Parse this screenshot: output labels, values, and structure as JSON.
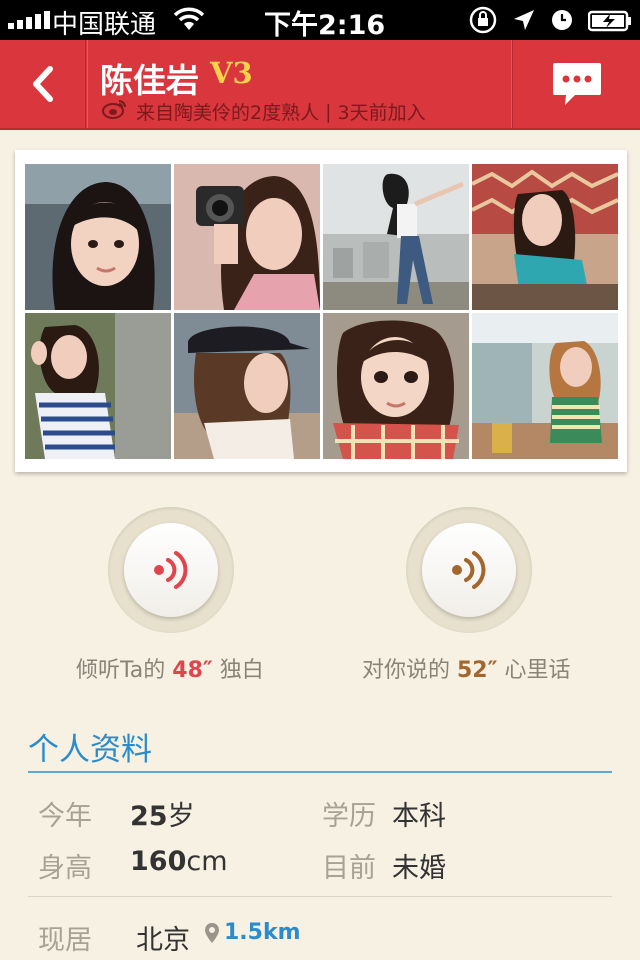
{
  "status_bar": {
    "carrier": "中国联通",
    "time": "下午2:16"
  },
  "header": {
    "name": "陈佳岩",
    "level": "V3",
    "source": "来自陶美伶的2度熟人",
    "joined": "3天前加入",
    "accent": "#d9373d"
  },
  "photos": {
    "count": 8
  },
  "voice": {
    "listen": {
      "prefix": "倾听Ta的 ",
      "seconds": "48″",
      "suffix": " 独白",
      "color": "#e0454e"
    },
    "reply": {
      "prefix": "对你说的 ",
      "seconds": "52″",
      "suffix": " 心里话",
      "color": "#a2662e"
    }
  },
  "profile": {
    "title": "个人资料",
    "age_label": "今年",
    "age_num": "25",
    "age_unit": "岁",
    "education_label": "学历",
    "education_value": "本科",
    "height_label": "身高",
    "height_num": "160",
    "height_unit": "cm",
    "status_label": "目前",
    "status_value": "未婚",
    "location_label": "现居",
    "location_value": "北京",
    "distance": "1.5km"
  }
}
